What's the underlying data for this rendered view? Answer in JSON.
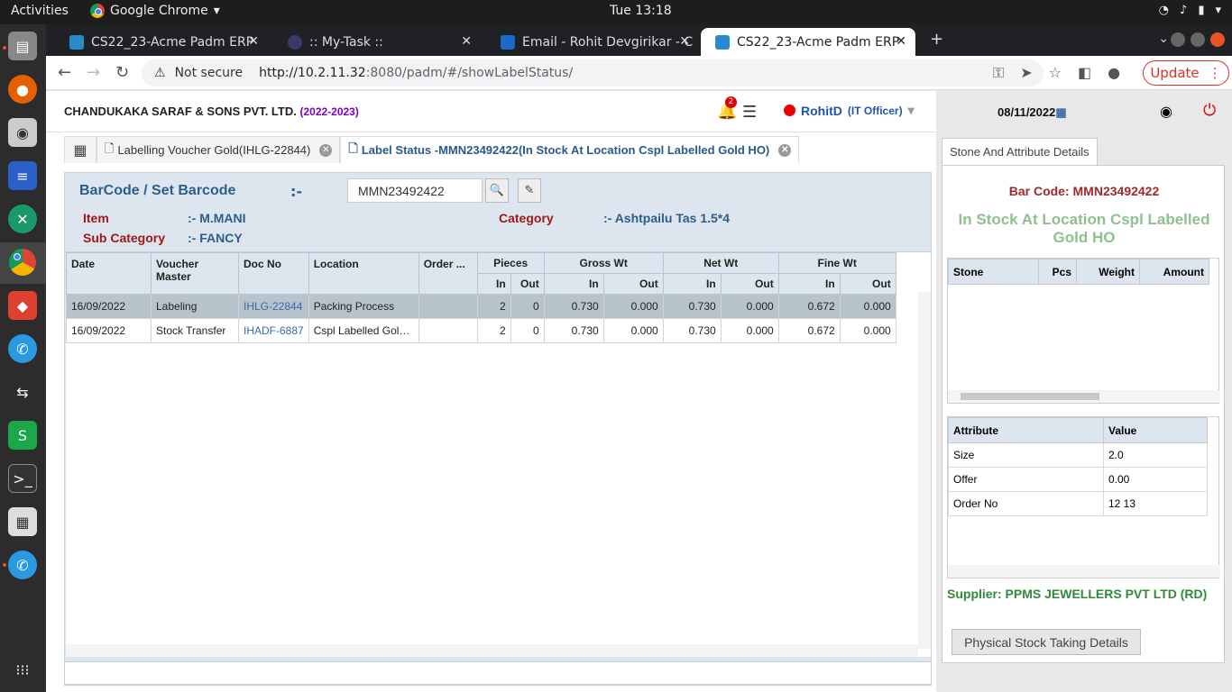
{
  "os": {
    "activities": "Activities",
    "app_name": "Google Chrome",
    "clock": "Tue 13:18"
  },
  "browser": {
    "tabs": [
      {
        "label": "CS22_23-Acme Padm ERP"
      },
      {
        "label": ":: My-Task ::"
      },
      {
        "label": "Email - Rohit Devgirikar - C"
      },
      {
        "label": "CS22_23-Acme Padm ERP"
      }
    ],
    "security": "Not secure",
    "url_host": "http://10.2.11.32",
    "url_rest": ":8080/padm/#/showLabelStatus/",
    "update_label": "Update"
  },
  "header": {
    "company": "CHANDUKAKA SARAF & SONS PVT. LTD.",
    "year": "(2022-2023)",
    "notif_count": "2",
    "user": "RohitD",
    "role": "(IT Officer)",
    "date": "08/11/2022"
  },
  "tabs": [
    {
      "label": "Labelling Voucher Gold(IHLG-22844)"
    },
    {
      "label": "Label Status -MMN23492422(In Stock At Location Cspl Labelled Gold HO)"
    }
  ],
  "main": {
    "barcode_label": "BarCode / Set Barcode",
    "barcode_sep": ":-",
    "barcode_value": "MMN23492422",
    "item_label": "Item",
    "item_value": ":- M.MANI",
    "category_label": "Category",
    "category_value": ":- Ashtpailu Tas 1.5*4",
    "subcat_label": "Sub Category",
    "subcat_value": ":- FANCY"
  },
  "grid": {
    "headers": {
      "date": "Date",
      "voucher": "Voucher Master",
      "doc": "Doc No",
      "location": "Location",
      "order": "Order ...",
      "pieces": "Pieces",
      "gross": "Gross Wt",
      "net": "Net Wt",
      "fine": "Fine Wt",
      "in": "In",
      "out": "Out"
    },
    "rows": [
      {
        "date": "16/09/2022",
        "voucher": "Labeling",
        "doc": "IHLG-22844",
        "location": "Packing Process",
        "order": "",
        "pin": "2",
        "pout": "0",
        "gin": "0.730",
        "gout": "0.000",
        "nin": "0.730",
        "nout": "0.000",
        "fin": "0.672",
        "fout": "0.000"
      },
      {
        "date": "16/09/2022",
        "voucher": "Stock Transfer",
        "doc": "IHADF-6887",
        "location": "Cspl Labelled Gol…",
        "order": "",
        "pin": "2",
        "pout": "0",
        "gin": "0.730",
        "gout": "0.000",
        "nin": "0.730",
        "nout": "0.000",
        "fin": "0.672",
        "fout": "0.000"
      }
    ]
  },
  "right": {
    "tab": "Stone And Attribute Details",
    "barcode": "Bar Code: MMN23492422",
    "status": "In Stock At Location Cspl Labelled Gold HO",
    "stone_headers": {
      "stone": "Stone",
      "pcs": "Pcs",
      "weight": "Weight",
      "amount": "Amount"
    },
    "attr_headers": {
      "attribute": "Attribute",
      "value": "Value"
    },
    "attributes": [
      {
        "name": "Size",
        "value": "2.0"
      },
      {
        "name": "Offer",
        "value": "0.00"
      },
      {
        "name": "Order No",
        "value": "12 13"
      }
    ],
    "supplier": "Supplier: PPMS JEWELLERS PVT LTD (RD)",
    "physical_btn": "Physical Stock Taking Details"
  }
}
